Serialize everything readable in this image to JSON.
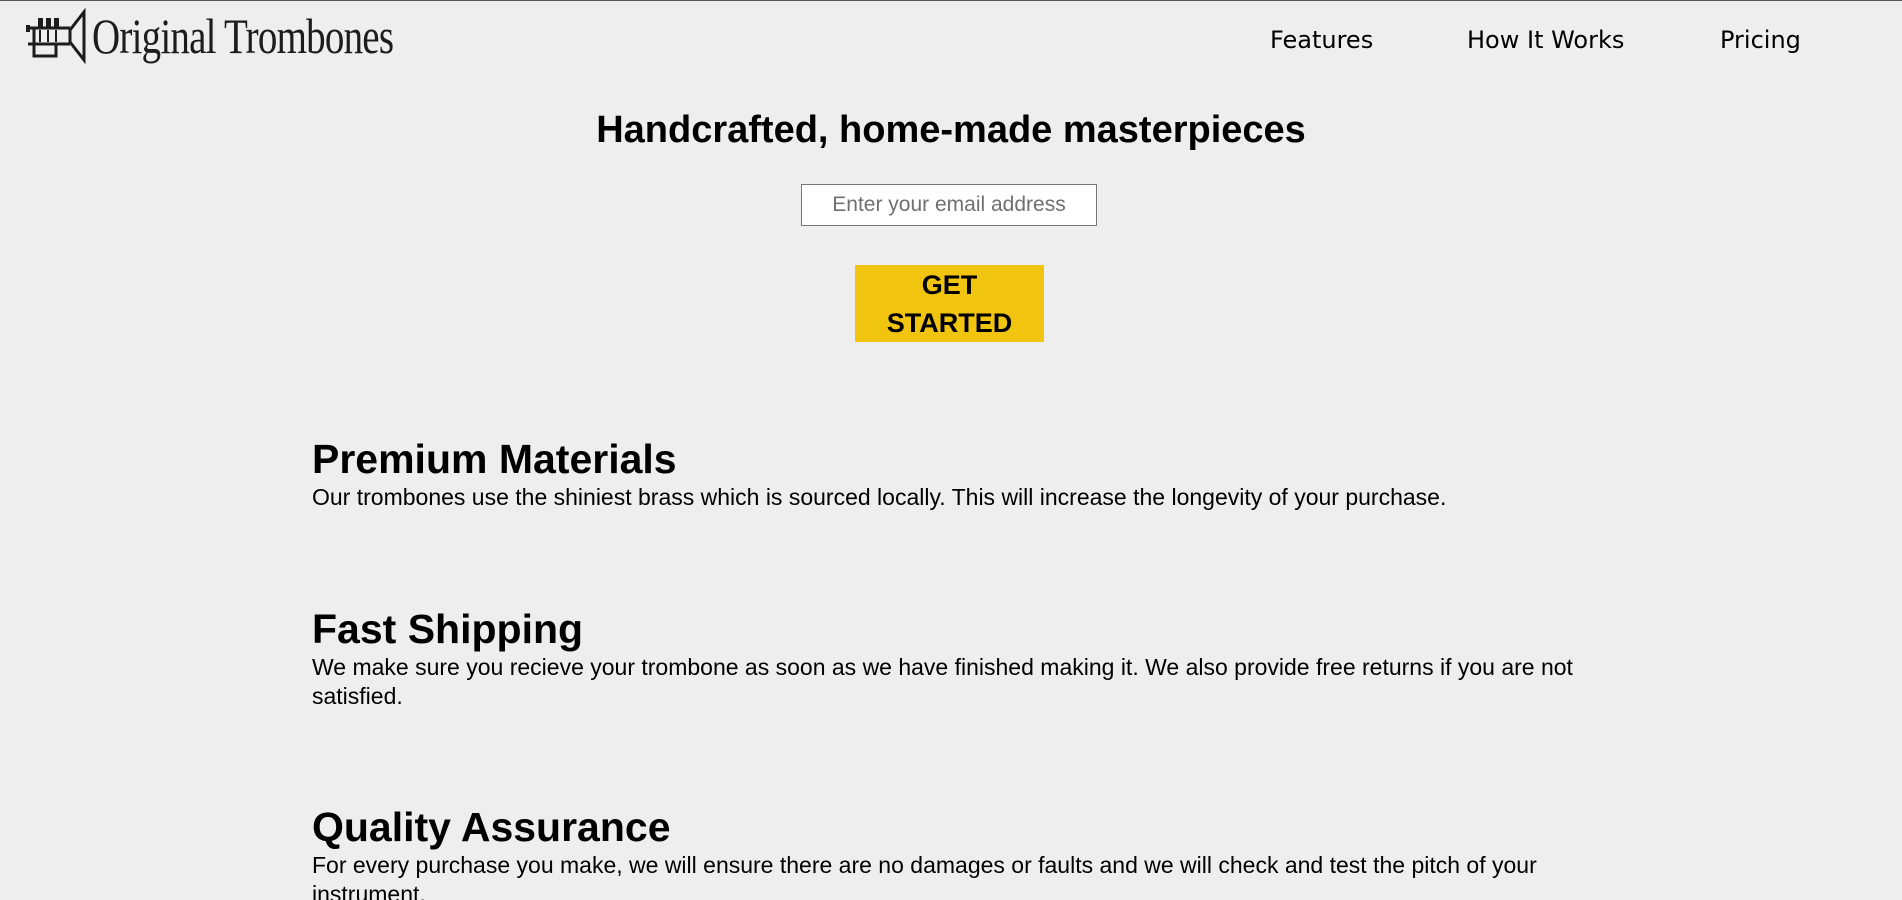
{
  "brand": {
    "name": "Original Trombones",
    "icon": "trombone-logo-icon"
  },
  "nav": {
    "items": [
      {
        "label": "Features"
      },
      {
        "label": "How It Works"
      },
      {
        "label": "Pricing"
      }
    ]
  },
  "hero": {
    "title": "Handcrafted, home-made masterpieces",
    "email_placeholder": "Enter your email address",
    "email_value": "",
    "cta_label": "GET STARTED",
    "cta_color": "#f1c40f"
  },
  "features": [
    {
      "title": "Premium Materials",
      "description": "Our trombones use the shiniest brass which is sourced locally. This will increase the longevity of your purchase."
    },
    {
      "title": "Fast Shipping",
      "description": "We make sure you recieve your trombone as soon as we have finished making it. We also provide free returns if you are not satisfied."
    },
    {
      "title": "Quality Assurance",
      "description": "For every purchase you make, we will ensure there are no damages or faults and we will check and test the pitch of your instrument."
    }
  ]
}
